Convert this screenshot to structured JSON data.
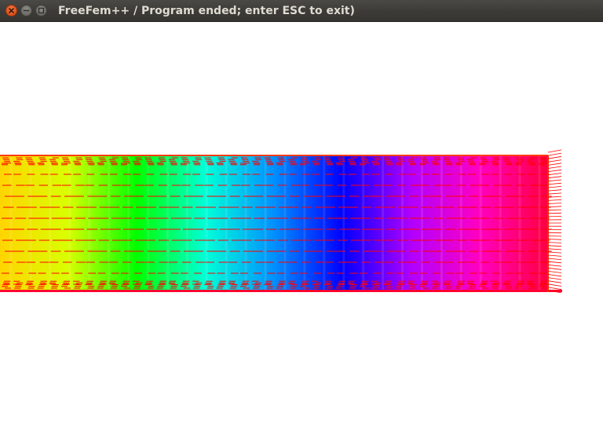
{
  "window": {
    "title": "FreeFem++ / Program ended; enter ESC to exit)",
    "close_icon": "close-icon",
    "minimize_icon": "minimize-icon",
    "maximize_icon": "maximize-icon",
    "titlebar_color": "#3c3b37",
    "close_color": "#e3571e"
  },
  "plot": {
    "description_type": "fem-vector-field-over-color-gradient",
    "colormap": [
      "#ffd500",
      "#d8ff00",
      "#00ff00",
      "#00ffd8",
      "#0090ff",
      "#0000ff",
      "#b000ff",
      "#ff00c0",
      "#ff0040"
    ],
    "arrow_color": "#ff0000",
    "background": "#ffffff"
  }
}
